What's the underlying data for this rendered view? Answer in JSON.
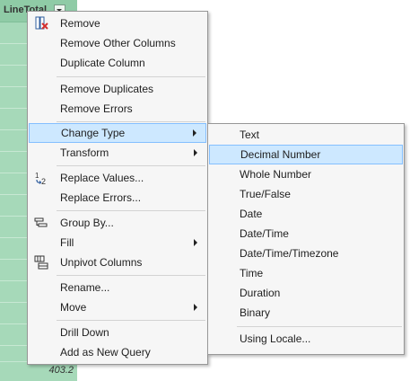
{
  "column": {
    "header": "LineTotal",
    "last_value": "403.2"
  },
  "context_menu": {
    "items": [
      {
        "label": "Remove"
      },
      {
        "label": "Remove Other Columns"
      },
      {
        "label": "Duplicate Column"
      },
      {
        "label": "Remove Duplicates"
      },
      {
        "label": "Remove Errors"
      },
      {
        "label": "Change Type"
      },
      {
        "label": "Transform"
      },
      {
        "label": "Replace Values..."
      },
      {
        "label": "Replace Errors..."
      },
      {
        "label": "Group By..."
      },
      {
        "label": "Fill"
      },
      {
        "label": "Unpivot Columns"
      },
      {
        "label": "Rename..."
      },
      {
        "label": "Move"
      },
      {
        "label": "Drill Down"
      },
      {
        "label": "Add as New Query"
      }
    ]
  },
  "change_type_submenu": {
    "items": [
      {
        "label": "Text"
      },
      {
        "label": "Decimal Number"
      },
      {
        "label": "Whole Number"
      },
      {
        "label": "True/False"
      },
      {
        "label": "Date"
      },
      {
        "label": "Date/Time"
      },
      {
        "label": "Date/Time/Timezone"
      },
      {
        "label": "Time"
      },
      {
        "label": "Duration"
      },
      {
        "label": "Binary"
      },
      {
        "label": "Using Locale..."
      }
    ]
  },
  "colors": {
    "column_bg": "#a6d9b9",
    "menu_bg": "#f6f6f6",
    "highlight_bg": "#cde8ff",
    "highlight_border": "#84bfff"
  }
}
